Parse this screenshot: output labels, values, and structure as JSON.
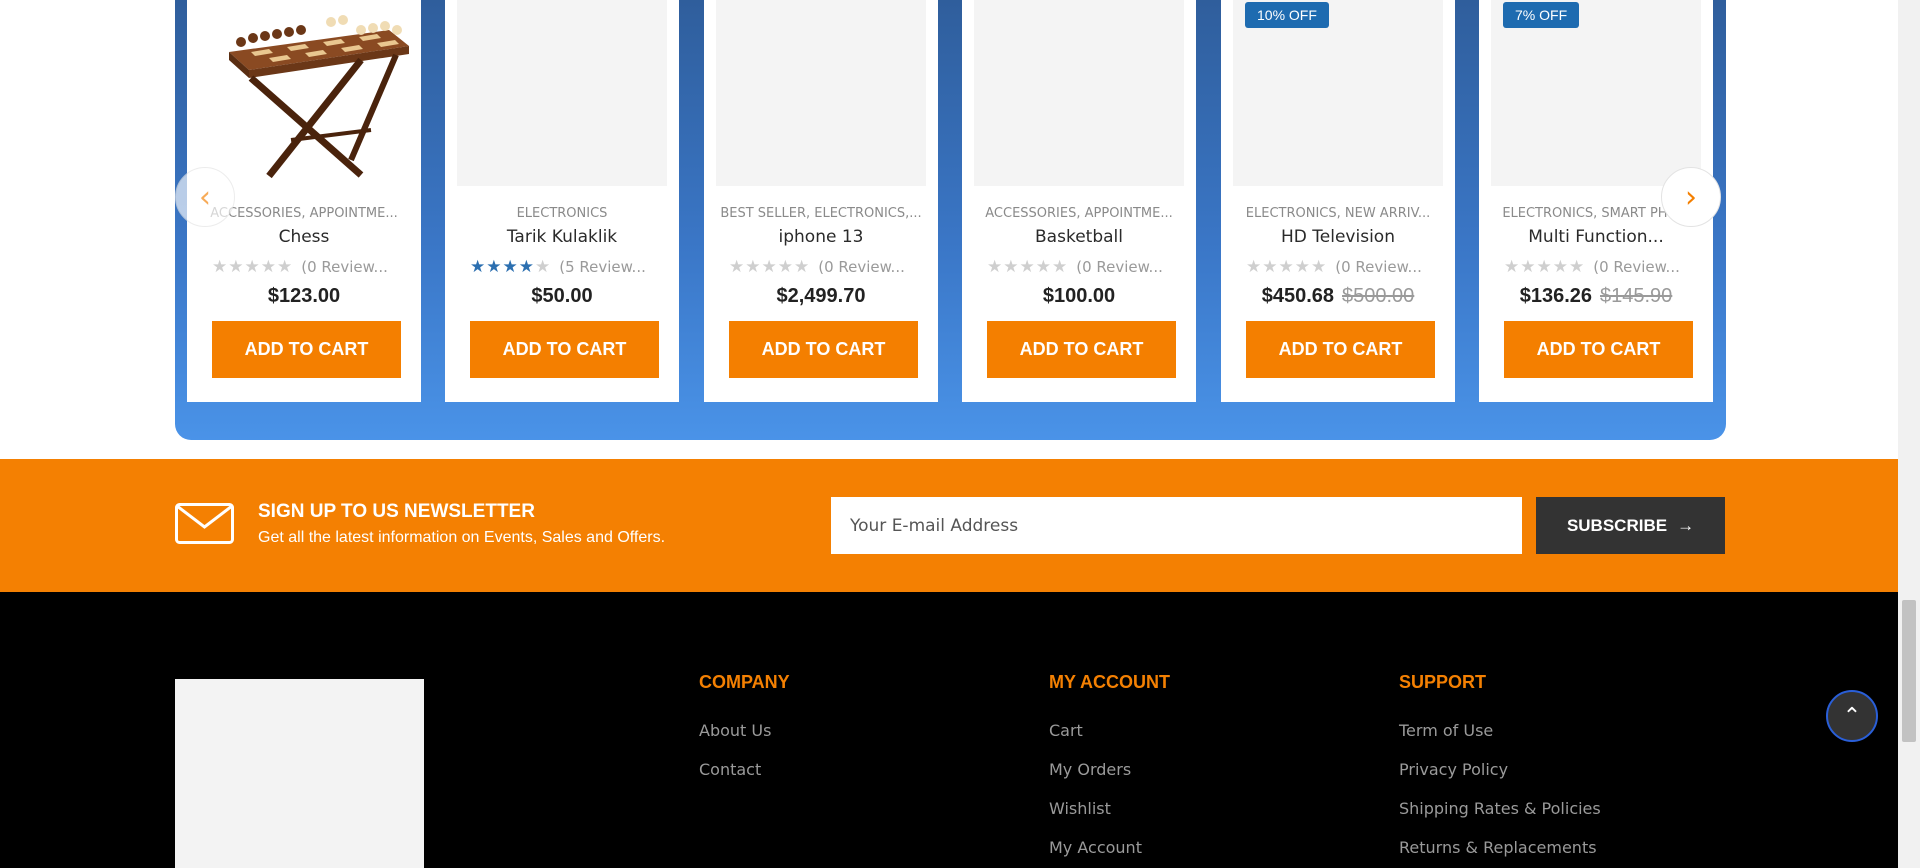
{
  "carousel": {
    "prev_icon": "chevron-left-icon",
    "next_icon": "chevron-right-icon",
    "prev_glyph": "‹",
    "next_glyph": "›",
    "products": [
      {
        "categories": "ACCESSORIES, APPOINTME...",
        "name": "Chess",
        "rating": 0,
        "reviews": "(0 Review...",
        "price": "$123.00",
        "old_price": "",
        "badge": "",
        "image": "chess-table"
      },
      {
        "categories": "ELECTRONICS",
        "name": "Tarik Kulaklik",
        "rating": 4,
        "reviews": "(5 Review...",
        "price": "$50.00",
        "old_price": "",
        "badge": ""
      },
      {
        "categories": "BEST SELLER, ELECTRONICS,...",
        "name": "iphone 13",
        "rating": 0,
        "reviews": "(0 Review...",
        "price": "$2,499.70",
        "old_price": "",
        "badge": ""
      },
      {
        "categories": "ACCESSORIES, APPOINTME...",
        "name": "Basketball",
        "rating": 0,
        "reviews": "(0 Review...",
        "price": "$100.00",
        "old_price": "",
        "badge": ""
      },
      {
        "categories": "ELECTRONICS, NEW ARRIV...",
        "name": "HD Television",
        "rating": 0,
        "reviews": "(0 Review...",
        "price": "$450.68",
        "old_price": "$500.00",
        "badge": "10% OFF"
      },
      {
        "categories": "ELECTRONICS, SMART PHO...",
        "name": "Multi Function...",
        "rating": 0,
        "reviews": "(0 Review...",
        "price": "$136.26",
        "old_price": "$145.90",
        "badge": "7% OFF"
      }
    ],
    "add_to_cart_label": "ADD TO CART"
  },
  "newsletter": {
    "icon": "mail-icon",
    "title": "SIGN UP TO US NEWSLETTER",
    "subtitle": "Get all the latest information on Events, Sales and Offers.",
    "email_placeholder": "Your E-mail Address",
    "subscribe_label": "SUBSCRIBE",
    "subscribe_arrow": "→"
  },
  "footer": {
    "company": {
      "title": "COMPANY",
      "links": [
        "About Us",
        "Contact"
      ]
    },
    "account": {
      "title": "MY ACCOUNT",
      "links": [
        "Cart",
        "My Orders",
        "Wishlist",
        "My Account"
      ]
    },
    "support": {
      "title": "SUPPORT",
      "links": [
        "Term of Use",
        "Privacy Policy",
        "Shipping Rates & Policies",
        "Returns & Replacements"
      ]
    }
  },
  "back_to_top": {
    "icon": "chevron-up-icon",
    "glyph": "⌃"
  },
  "colors": {
    "accent": "#f48002",
    "badge": "#1e6bb0",
    "star_on": "#2c6fb0",
    "carousel_top": "#2f5e9c",
    "carousel_bottom": "#4a93e8"
  }
}
